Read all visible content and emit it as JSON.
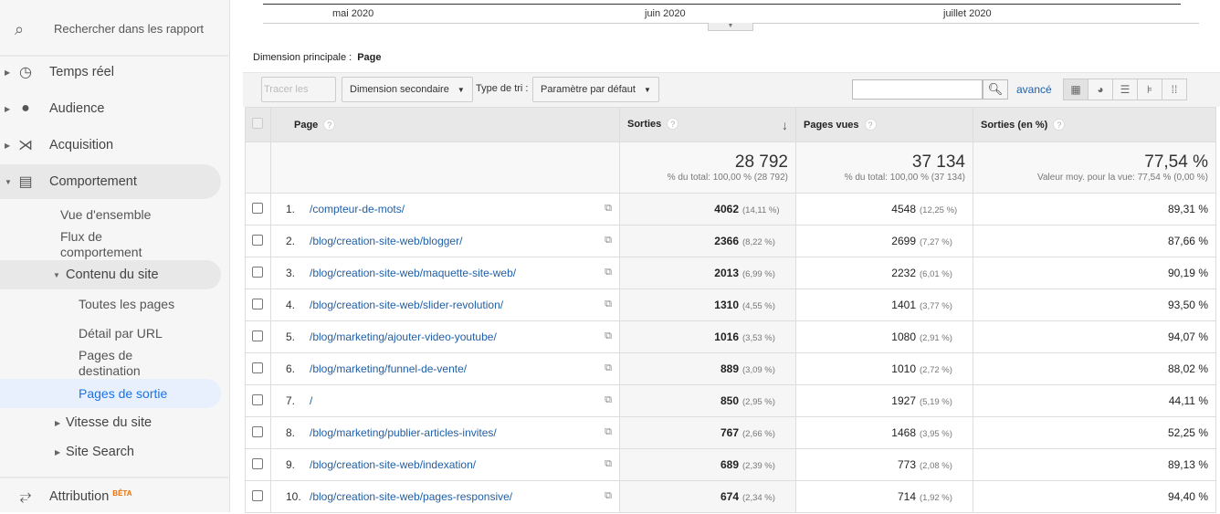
{
  "sidebar": {
    "search_placeholder": "Rechercher dans les rapport",
    "items": [
      {
        "label": "Temps réel",
        "icon": "clock-icon"
      },
      {
        "label": "Audience",
        "icon": "person-icon"
      },
      {
        "label": "Acquisition",
        "icon": "acquisition-icon"
      },
      {
        "label": "Comportement",
        "icon": "behavior-icon"
      }
    ],
    "behavior_sub": [
      "Vue d'ensemble",
      "Flux de comportement"
    ],
    "site_content": "Contenu du site",
    "site_content_sub": [
      "Toutes les pages",
      "Détail par URL",
      "Pages de destination",
      "Pages de sortie"
    ],
    "more": [
      "Vitesse du site",
      "Site Search"
    ],
    "attribution": "Attribution",
    "beta": "BÊTA"
  },
  "chart_axis": [
    "mai 2020",
    "juin 2020",
    "juillet 2020"
  ],
  "primary_dimension": {
    "label": "Dimension principale :",
    "value": "Page"
  },
  "toolbar": {
    "plot_rows": "Tracer les lignes",
    "secondary_dimension": "Dimension secondaire",
    "sort_type_label": "Type de tri :",
    "sort_type_value": "Paramètre par défaut",
    "search_value": "",
    "advanced": "avancé"
  },
  "table": {
    "headers": [
      "Page",
      "Sorties",
      "Pages vues",
      "Sorties (en %)"
    ],
    "totals": {
      "exits": "28 792",
      "exits_sub": "% du total: 100,00 % (28 792)",
      "views": "37 134",
      "views_sub": "% du total: 100,00 % (37 134)",
      "rate": "77,54 %",
      "rate_sub": "Valeur moy. pour la vue: 77,54 % (0,00 %)"
    },
    "rows": [
      {
        "n": "1.",
        "page": "/compteur-de-mots/",
        "exits": "4062",
        "exits_pct": "(14,11 %)",
        "views": "4548",
        "views_pct": "(12,25 %)",
        "rate": "89,31 %"
      },
      {
        "n": "2.",
        "page": "/blog/creation-site-web/blogger/",
        "exits": "2366",
        "exits_pct": "(8,22 %)",
        "views": "2699",
        "views_pct": "(7,27 %)",
        "rate": "87,66 %"
      },
      {
        "n": "3.",
        "page": "/blog/creation-site-web/maquette-site-web/",
        "exits": "2013",
        "exits_pct": "(6,99 %)",
        "views": "2232",
        "views_pct": "(6,01 %)",
        "rate": "90,19 %"
      },
      {
        "n": "4.",
        "page": "/blog/creation-site-web/slider-revolution/",
        "exits": "1310",
        "exits_pct": "(4,55 %)",
        "views": "1401",
        "views_pct": "(3,77 %)",
        "rate": "93,50 %"
      },
      {
        "n": "5.",
        "page": "/blog/marketing/ajouter-video-youtube/",
        "exits": "1016",
        "exits_pct": "(3,53 %)",
        "views": "1080",
        "views_pct": "(2,91 %)",
        "rate": "94,07 %"
      },
      {
        "n": "6.",
        "page": "/blog/marketing/funnel-de-vente/",
        "exits": "889",
        "exits_pct": "(3,09 %)",
        "views": "1010",
        "views_pct": "(2,72 %)",
        "rate": "88,02 %"
      },
      {
        "n": "7.",
        "page": "/",
        "exits": "850",
        "exits_pct": "(2,95 %)",
        "views": "1927",
        "views_pct": "(5,19 %)",
        "rate": "44,11 %"
      },
      {
        "n": "8.",
        "page": "/blog/marketing/publier-articles-invites/",
        "exits": "767",
        "exits_pct": "(2,66 %)",
        "views": "1468",
        "views_pct": "(3,95 %)",
        "rate": "52,25 %"
      },
      {
        "n": "9.",
        "page": "/blog/creation-site-web/indexation/",
        "exits": "689",
        "exits_pct": "(2,39 %)",
        "views": "773",
        "views_pct": "(2,08 %)",
        "rate": "89,13 %"
      },
      {
        "n": "10.",
        "page": "/blog/creation-site-web/pages-responsive/",
        "exits": "674",
        "exits_pct": "(2,34 %)",
        "views": "714",
        "views_pct": "(1,92 %)",
        "rate": "94,40 %"
      }
    ]
  }
}
